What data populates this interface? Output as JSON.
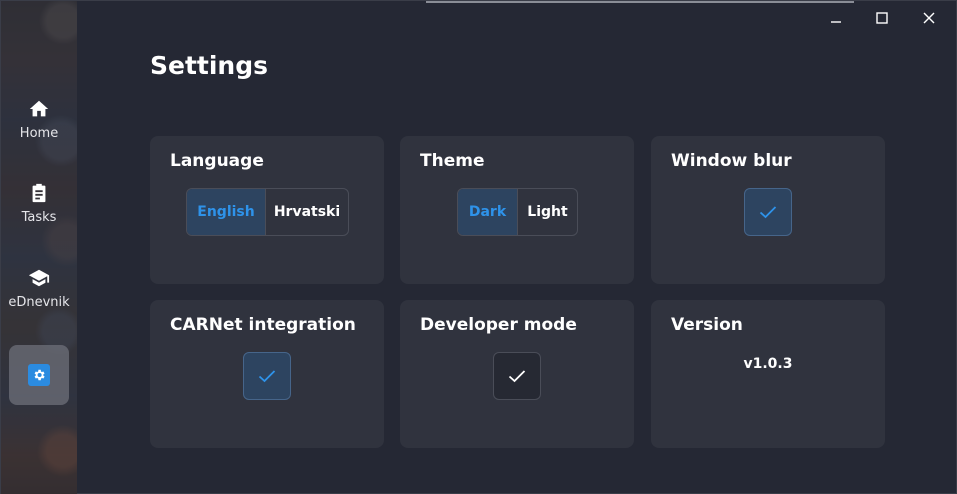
{
  "page": {
    "title": "Settings"
  },
  "sidebar": {
    "items": [
      {
        "label": "Home",
        "icon": "home-icon"
      },
      {
        "label": "Tasks",
        "icon": "clipboard-icon"
      },
      {
        "label": "eDnevnik",
        "icon": "graduation-cap-icon"
      },
      {
        "label": "",
        "icon": "gear-icon",
        "active": true
      }
    ]
  },
  "window_controls": {
    "minimize": "minimize-icon",
    "maximize": "maximize-icon",
    "close": "close-icon"
  },
  "cards": {
    "language": {
      "title": "Language",
      "options": [
        "English",
        "Hrvatski"
      ],
      "selected": "English"
    },
    "theme": {
      "title": "Theme",
      "options": [
        "Dark",
        "Light"
      ],
      "selected": "Dark"
    },
    "window_blur": {
      "title": "Window blur",
      "checked": true
    },
    "carnet": {
      "title": "CARNet integration",
      "checked": true
    },
    "developer": {
      "title": "Developer mode",
      "checked": false
    },
    "version": {
      "title": "Version",
      "value": "v1.0.3"
    }
  },
  "colors": {
    "accent": "#2e93ea",
    "accent_bg": "#2d4460",
    "card_bg": "#30333e",
    "window_bg": "#252834"
  }
}
